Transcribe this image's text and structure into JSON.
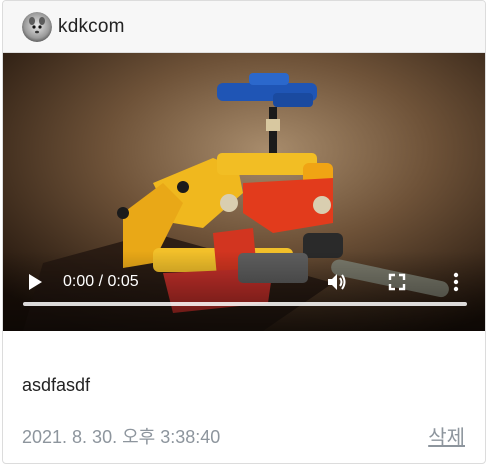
{
  "post": {
    "author": "kdkcom",
    "text": "asdfasdf",
    "date": "2021. 8. 30. 오후 3:38:40",
    "delete_label": "삭제"
  },
  "video": {
    "time_display": "0:00 / 0:05",
    "progress": 0.0,
    "icons": {
      "play": "play-icon",
      "volume": "volume-icon",
      "fullscreen": "fullscreen-icon",
      "more": "more-vert-icon"
    }
  },
  "colors": {
    "header_bg": "#f7f7f7",
    "muted_text": "#8d959d",
    "body_text": "#222222"
  }
}
